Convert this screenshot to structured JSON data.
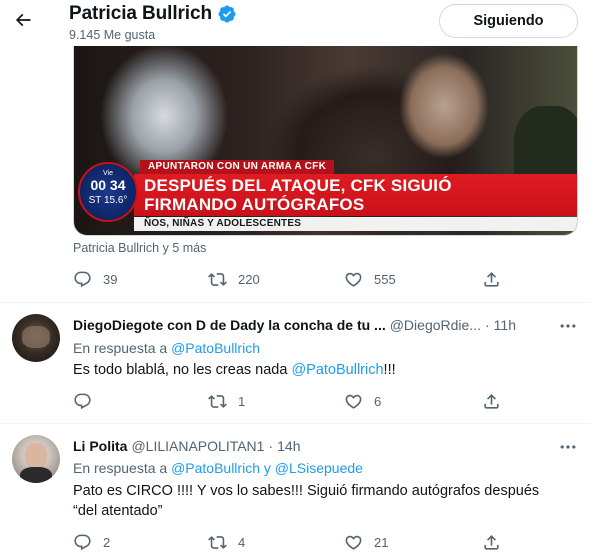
{
  "header": {
    "name": "Patricia Bullrich",
    "likes": "9.145 Me gusta",
    "follow_label": "Siguiendo"
  },
  "media": {
    "clock_day": "Vie",
    "clock_time": "00 34",
    "clock_temp": "ST 15.6°",
    "band_top": "APUNTARON CON UN ARMA A CFK",
    "headline_1": "DESPUÉS DEL ATAQUE, CFK SIGUIÓ",
    "headline_2": "FIRMANDO AUTÓGRAFOS",
    "band_bottom": "ÑOS, NIÑAS Y ADOLESCENTES"
  },
  "main_tweet": {
    "reposted_by": "Patricia Bullrich y 5 más",
    "replies": "39",
    "retweets": "220",
    "likes": "555"
  },
  "replies": [
    {
      "name": "DiegoDiegote con D de Dady la concha de tu ...",
      "handle": "@DiegoRdie...",
      "dot": "·",
      "time": "11h",
      "reply_prefix": "En respuesta a ",
      "reply_mention_1": "@PatoBullrich",
      "reply_join": "",
      "reply_mention_2": "",
      "text_before": "Es todo blablá, no les creas nada ",
      "text_mention": "@PatoBullrich",
      "text_after": "!!!",
      "replies": "",
      "retweets": "1",
      "likes": "6"
    },
    {
      "name": "Li Polita",
      "handle": "@LILIANAPOLITAN1",
      "dot": "·",
      "time": "14h",
      "reply_prefix": "En respuesta a ",
      "reply_mention_1": "@PatoBullrich",
      "reply_join": " y ",
      "reply_mention_2": "@LSisepuede",
      "text_line_1": "Pato es CIRCO !!!! Y vos lo sabes!!! Siguió firmando autógrafos después",
      "text_line_2": "“del atentado”",
      "replies": "2",
      "retweets": "4",
      "likes": "21"
    }
  ],
  "icons": {
    "back": "arrow-left-icon",
    "verified": "verified-badge-icon",
    "reply": "reply-icon",
    "retweet": "retweet-icon",
    "like": "heart-icon",
    "share": "share-icon",
    "more": "more-icon"
  },
  "colors": {
    "accent": "#1d9bf0",
    "muted": "#536471",
    "text": "#0f1419",
    "divider": "#eff3f4"
  }
}
